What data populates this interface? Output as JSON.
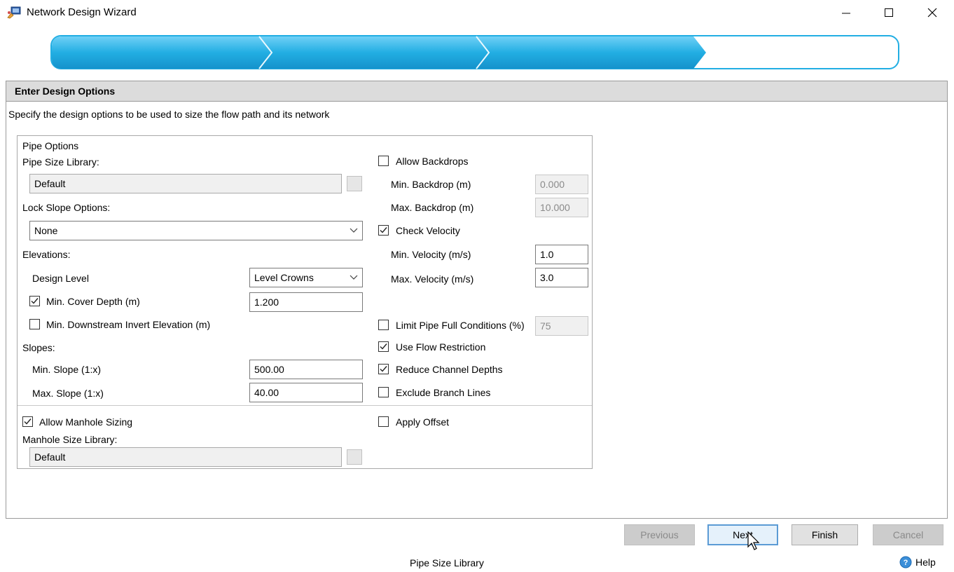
{
  "window": {
    "title": "Network Design Wizard",
    "minimize_glyph": "—",
    "maximize_glyph": "☐",
    "close_glyph": "✕"
  },
  "wizard": {
    "completed_steps": 3,
    "total_steps": 4,
    "accent": "#1aa7df"
  },
  "header": {
    "title": "Enter Design Options",
    "description": "Specify the design options to be used to size the flow path and its network"
  },
  "pipe_options": {
    "group_label": "Pipe Options",
    "pipe_size_library_label": "Pipe Size Library:",
    "pipe_size_library_value": "Default",
    "lock_slope_label": "Lock Slope Options:",
    "lock_slope_value": "None",
    "elevations_label": "Elevations:",
    "design_level_label": "Design Level",
    "design_level_value": "Level Crowns",
    "min_cover_label": "Min. Cover Depth (m)",
    "min_cover_checked": true,
    "min_cover_value": "1.200",
    "min_downstream_label": "Min. Downstream Invert Elevation (m)",
    "min_downstream_checked": false,
    "slopes_label": "Slopes:",
    "min_slope_label": "Min. Slope (1:x)",
    "min_slope_value": "500.00",
    "max_slope_label": "Max. Slope (1:x)",
    "max_slope_value": "40.00",
    "allow_manhole_label": "Allow Manhole Sizing",
    "allow_manhole_checked": true,
    "manhole_library_label": "Manhole Size Library:",
    "manhole_library_value": "Default"
  },
  "right_options": {
    "allow_backdrops_label": "Allow Backdrops",
    "allow_backdrops_checked": false,
    "min_backdrop_label": "Min. Backdrop (m)",
    "min_backdrop_value": "0.000",
    "max_backdrop_label": "Max. Backdrop (m)",
    "max_backdrop_value": "10.000",
    "check_velocity_label": "Check Velocity",
    "check_velocity_checked": true,
    "min_velocity_label": "Min. Velocity (m/s)",
    "min_velocity_value": "1.0",
    "max_velocity_label": "Max. Velocity (m/s)",
    "max_velocity_value": "3.0",
    "limit_pipe_full_label": "Limit Pipe Full Conditions (%)",
    "limit_pipe_full_checked": false,
    "limit_pipe_full_value": "75",
    "use_flow_restriction_label": "Use Flow Restriction",
    "use_flow_restriction_checked": true,
    "reduce_channel_label": "Reduce Channel Depths",
    "reduce_channel_checked": true,
    "exclude_branch_label": "Exclude Branch Lines",
    "exclude_branch_checked": false,
    "apply_offset_label": "Apply Offset",
    "apply_offset_checked": false
  },
  "buttons": {
    "previous": "Previous",
    "next": "Next",
    "finish": "Finish",
    "cancel": "Cancel"
  },
  "status": {
    "context_label": "Pipe Size Library",
    "help_label": "Help"
  }
}
